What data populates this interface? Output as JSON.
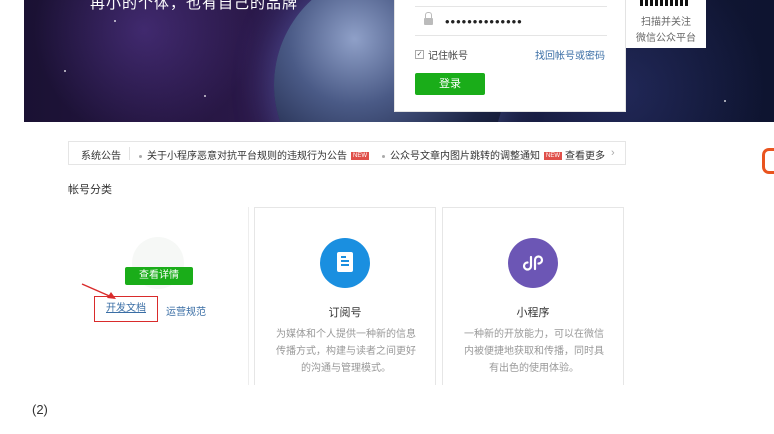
{
  "banner": {
    "slogan": "再小的个体，也有自己的品牌"
  },
  "login": {
    "password_mask": "••••••••••••••",
    "remember_label": "记住帐号",
    "forgot_link": "找回帐号或密码",
    "login_button": "登录"
  },
  "qr": {
    "line1": "扫描并关注",
    "line2": "微信公众平台"
  },
  "notice": {
    "title": "系统公告",
    "items": [
      {
        "text": "关于小程序恶意对抗平台规则的违规行为公告",
        "badge": "NEW"
      },
      {
        "text": "公众号文章内图片跳转的调整通知",
        "badge": "NEW"
      }
    ],
    "more": "查看更多"
  },
  "section_title": "帐号分类",
  "ghost_card": {
    "detail_button": "查看详情",
    "dev_doc_link": "开发文档",
    "ops_link": "运营规范"
  },
  "cards": [
    {
      "icon": "document-icon",
      "name": "订阅号",
      "desc": "为媒体和个人提供一种新的信息传播方式，构建与读者之间更好的沟通与管理模式。",
      "color": "#1a8fe0"
    },
    {
      "icon": "mini-program-icon",
      "name": "小程序",
      "desc": "一种新的开放能力，可以在微信内被便捷地获取和传播，同时具有出色的使用体验。",
      "color": "#6c56b5"
    }
  ],
  "caption": "(2)",
  "colors": {
    "brand_green": "#1aad19",
    "highlight_red": "#d92b2b",
    "link_blue": "#3a6ea5"
  }
}
